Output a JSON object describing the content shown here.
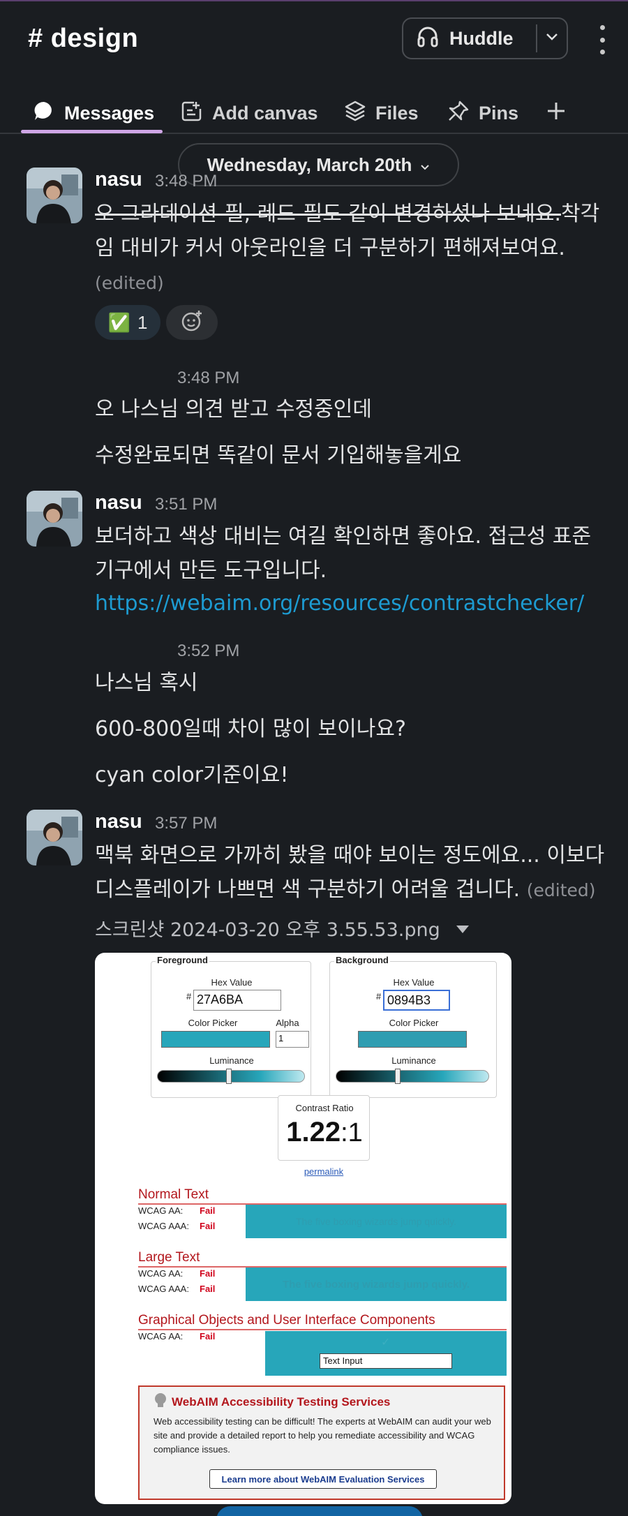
{
  "header": {
    "channel_name": "# design",
    "huddle_label": "Huddle"
  },
  "tabs": [
    {
      "label": "Messages",
      "icon": "message-bubble-icon"
    },
    {
      "label": "Add canvas",
      "icon": "canvas-icon"
    },
    {
      "label": "Files",
      "icon": "files-stack-icon"
    },
    {
      "label": "Pins",
      "icon": "pin-icon"
    }
  ],
  "date_divider": "Wednesday, March 20th",
  "messages": [
    {
      "author": "nasu",
      "time": "3:48 PM",
      "text_struck": "오 그라데이션-필, 레드-필도 같이 변경하셨나 보네요.",
      "text_rest": "착각임 대비가 커서 아웃라인을 더 구분하기 편해져보여요.",
      "edited": "(edited)",
      "reaction": {
        "emoji": "✅",
        "count": "1"
      }
    },
    {
      "time": "3:48 PM",
      "lines": [
        "오 나스님 의견 받고 수정중인데",
        "수정완료되면 똑같이 문서 기입해놓을게요"
      ]
    },
    {
      "author": "nasu",
      "time": "3:51 PM",
      "text": "보더하고 색상 대비는 여길 확인하면 좋아요. 접근성 표준 기구에서 만든 도구입니다.",
      "link": "https://webaim.org/resources/contrastchecker/"
    },
    {
      "time": "3:52 PM",
      "lines": [
        "나스님 혹시",
        "600-800일때 차이 많이 보이나요?",
        "cyan color기준이요!"
      ]
    },
    {
      "author": "nasu",
      "time": "3:57 PM",
      "text": "맥북 화면으로 가까히 봤을 때야 보이는 정도에요... 이보다 디스플레이가 나쁘면 색 구분하기 어려울 겁니다.",
      "edited": "(edited)",
      "attachment_name": "스크린샷 2024-03-20 오후 3.55.53.png"
    }
  ],
  "screenshot": {
    "foreground": {
      "legend": "Foreground",
      "hex_label": "Hex Value",
      "hex": "27A6BA",
      "picker_label": "Color Picker",
      "alpha_label": "Alpha",
      "alpha": "1",
      "luminance_label": "Luminance"
    },
    "background": {
      "legend": "Background",
      "hex_label": "Hex Value",
      "hex": "0894B3",
      "picker_label": "Color Picker",
      "luminance_label": "Luminance"
    },
    "contrast_label": "Contrast Ratio",
    "contrast_value": "1.22",
    "contrast_suffix": ":1",
    "permalink": "permalink",
    "sections": [
      {
        "title": "Normal Text",
        "rows": [
          {
            "label": "WCAG AA:",
            "result": "Fail"
          },
          {
            "label": "WCAG AAA:",
            "result": "Fail"
          }
        ],
        "sample": "The five boxing wizards jump quickly."
      },
      {
        "title": "Large Text",
        "rows": [
          {
            "label": "WCAG AA:",
            "result": "Fail"
          },
          {
            "label": "WCAG AAA:",
            "result": "Fail"
          }
        ],
        "sample": "The five boxing wizards jump quickly."
      },
      {
        "title": "Graphical Objects and User Interface Components",
        "rows": [
          {
            "label": "WCAG AA:",
            "result": "Fail"
          }
        ],
        "sample": "Text Input"
      }
    ],
    "ad": {
      "title": "WebAIM Accessibility Testing Services",
      "body": "Web accessibility testing can be difficult! The experts at WebAIM can audit your web site and provide a detailed report to help you remediate accessibility and WCAG compliance issues.",
      "button": "Learn more about WebAIM Evaluation Services"
    }
  },
  "colors": {
    "background": "#1a1d21",
    "accent_tab": "#cfa6e6",
    "link": "#1d9bd1",
    "swatch_fg": "#27a6ba",
    "swatch_bg": "#0894b3"
  }
}
